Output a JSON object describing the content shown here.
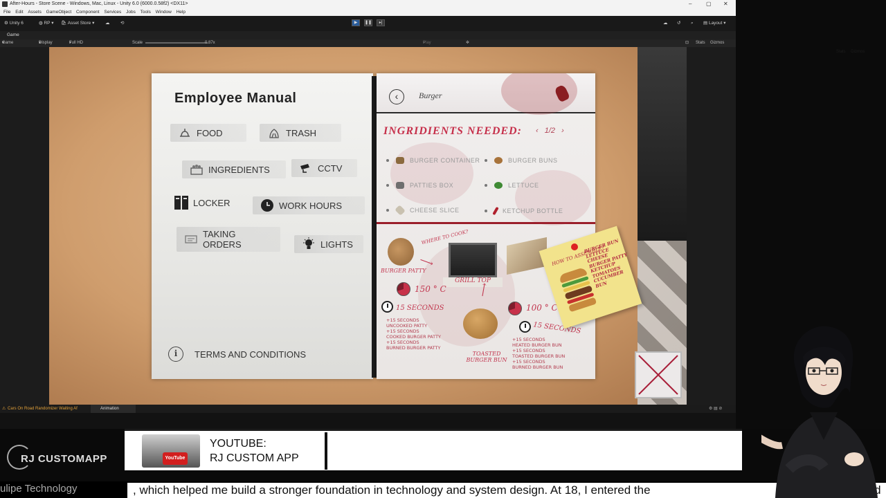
{
  "window": {
    "title": "After-Hours - Store Scene - Windows, Mac, Linux - Unity 6.0 (6000.0.58f2) <DX11>",
    "controls": [
      "–",
      "▢",
      "✕"
    ]
  },
  "menubar": [
    "File",
    "Edit",
    "Assets",
    "GameObject",
    "Component",
    "Services",
    "Jobs",
    "Tools",
    "Window",
    "Help"
  ],
  "toolbar": {
    "account": "Unity 6",
    "rp": "RP",
    "asset_store": "Asset Store",
    "layout": "Layout"
  },
  "game_tab": {
    "label": "Game",
    "mode": "Game",
    "display": "Display 1",
    "resolution": "Full HD (1920x1080)",
    "scale_label": "Scale",
    "scale_value": "0.87x",
    "play_focused": "Play Focused",
    "stats": "Stats",
    "gizmos": "Gizmos"
  },
  "status": {
    "warning": "Cars On Road Randomizer Waiting Af",
    "animation_tab": "Animation"
  },
  "manual": {
    "title": "Employee Manual",
    "items": [
      {
        "label": "FOOD",
        "icon": "food-icon"
      },
      {
        "label": "TRASH",
        "icon": "trash-icon"
      },
      {
        "label": "INGREDIENTS",
        "icon": "ingredients-icon"
      },
      {
        "label": "CCTV",
        "icon": "cctv-icon"
      },
      {
        "label": "LOCKER",
        "icon": "locker-icon"
      },
      {
        "label": "WORK HOURS",
        "icon": "clock-icon"
      },
      {
        "label": "TAKING ORDERS",
        "icon": "orders-icon"
      },
      {
        "label": "LIGHTS",
        "icon": "light-bulb-icon"
      }
    ],
    "terms": "TERMS AND CONDITIONS"
  },
  "recipe": {
    "title": "Burger",
    "ingredients_heading": "INGRIDIENTS NEEDED:",
    "page": "1/2",
    "ingredients": [
      {
        "name": "BURGER CONTAINER",
        "color": "#8b6a3e"
      },
      {
        "name": "BURGER BUNS",
        "color": "#a8733b"
      },
      {
        "name": "PATTIES BOX",
        "color": "#6e6e6e"
      },
      {
        "name": "LETTUCE",
        "color": "#3f8a34"
      },
      {
        "name": "CHEESE SLICE",
        "color": "#c9c1b0"
      },
      {
        "name": "KETCHUP BOTTLE",
        "color": "#b0202c"
      }
    ],
    "notes": {
      "where_to_cook": "WHERE TO COOK?",
      "burger_patty": "BURGER PATTY",
      "grill_top": "GRILL TOP",
      "temp1": "150 ° C",
      "time1": "15 SECONDS",
      "temp2": "100 ° C",
      "time2": "15 SECONDS",
      "toasted": "TOASTED BURGER BUN",
      "patty_steps": "+15 SECONDS\nUNCOOKED PATTY\n+15 SECONDS\nCOOKED BURGER PATTY\n+15 SECONDS\nBURNED BURGER PATTY",
      "bun_steps": "+15 SECONDS\nHEATED BURGER BUN\n+15 SECONDS\nTOASTED BURGER BUN\n+15 SECONDS\nBURNED BURGER BUN"
    },
    "sticky_note": {
      "title": "HOW TO ASSEMBLE?",
      "steps": "BURGER BUN\nLETTUCE\nCHEESE\nBURGER PATTY\nKETCHUP\nTOMATOES\nCUCUMBER\nBUN"
    }
  },
  "overlay": {
    "youtube_line1": "YOUTUBE:",
    "youtube_line2": "RJ CUSTOM APP",
    "logo_text": "RJ CUSTOMAPP",
    "ticker": ", which helped me build a stronger foundation in technology and system design. At 18, I entered the",
    "ticker_right": "world",
    "ticker_left": "ulipe Technology"
  }
}
